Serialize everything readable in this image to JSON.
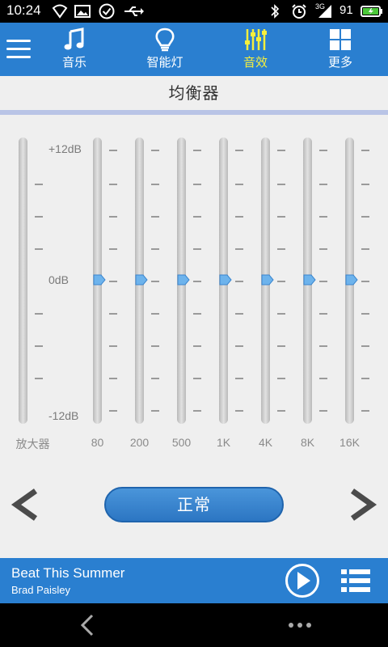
{
  "status_bar": {
    "time": "10:24",
    "network": "3G",
    "battery": "91"
  },
  "nav": {
    "tabs": [
      {
        "label": "音乐",
        "icon": "music-note-icon"
      },
      {
        "label": "智能灯",
        "icon": "light-bulb-icon"
      },
      {
        "label": "音效",
        "icon": "sliders-icon",
        "active": true
      },
      {
        "label": "更多",
        "icon": "grid-icon"
      }
    ],
    "active_color": "#f6ef3c"
  },
  "page": {
    "title": "均衡器"
  },
  "equalizer": {
    "db_labels": [
      "+12dB",
      "0dB",
      "-12dB"
    ],
    "bands": [
      {
        "label": "放大器",
        "gain_db": 0
      },
      {
        "label": "80",
        "gain_db": 0
      },
      {
        "label": "200",
        "gain_db": 0
      },
      {
        "label": "500",
        "gain_db": 0
      },
      {
        "label": "1K",
        "gain_db": 0
      },
      {
        "label": "4K",
        "gain_db": 0
      },
      {
        "label": "8K",
        "gain_db": 0
      },
      {
        "label": "16K",
        "gain_db": 0
      }
    ]
  },
  "preset": {
    "label": "正常"
  },
  "player": {
    "song": "Beat This Summer",
    "artist": "Brad Paisley"
  },
  "colors": {
    "primary": "#2a7fd0",
    "active_tab": "#f6ef3c",
    "background": "#efefef"
  }
}
